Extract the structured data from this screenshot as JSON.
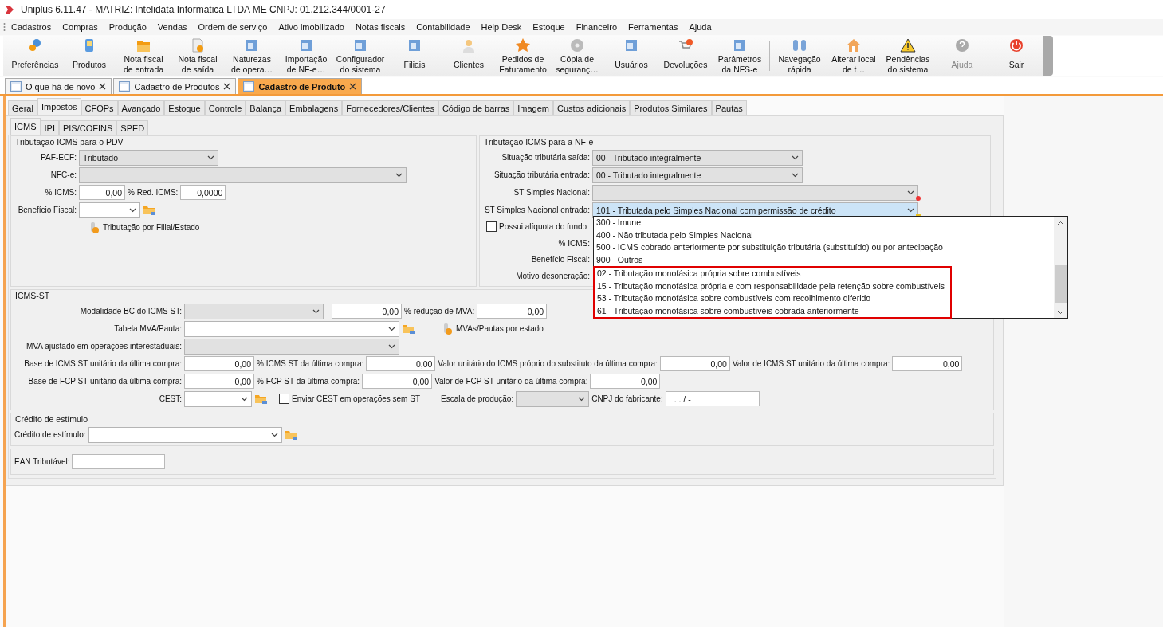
{
  "window": {
    "title": "Uniplus 6.11.47 - MATRIZ: Intelidata Informatica LTDA ME CNPJ: 01.212.344/0001-27"
  },
  "menu": [
    "Cadastros",
    "Compras",
    "Produção",
    "Vendas",
    "Ordem de serviço",
    "Ativo imobilizado",
    "Notas fiscais",
    "Contabilidade",
    "Help Desk",
    "Estoque",
    "Financeiro",
    "Ferramentas",
    "Ajuda"
  ],
  "toolbar": {
    "groups": [
      {
        "buttons": [
          {
            "label": "Preferências",
            "disabled": false
          },
          {
            "label": "Produtos",
            "disabled": false
          },
          {
            "label": "Nota fiscal\nde entrada",
            "disabled": false
          },
          {
            "label": "Nota fiscal\nde saída",
            "disabled": false
          },
          {
            "label": "Naturezas\nde opera…",
            "disabled": false
          },
          {
            "label": "Importação\nde NF-e…",
            "disabled": false
          },
          {
            "label": "Configurador\ndo sistema",
            "disabled": false
          },
          {
            "label": "Filiais",
            "disabled": false
          },
          {
            "label": "Clientes",
            "disabled": false
          },
          {
            "label": "Pedidos de\nFaturamento",
            "disabled": false
          },
          {
            "label": "Cópia de\nseguranç…",
            "disabled": false
          },
          {
            "label": "Usuários",
            "disabled": false
          },
          {
            "label": "Devoluções",
            "disabled": false
          },
          {
            "label": "Parâmetros\nda NFS-e",
            "disabled": false
          }
        ]
      },
      {
        "buttons": [
          {
            "label": "Navegação\nrápida",
            "disabled": false
          },
          {
            "label": "Alterar local\nde t…",
            "disabled": false
          },
          {
            "label": "Pendências\ndo sistema",
            "disabled": false
          },
          {
            "label": "Ajuda",
            "disabled": true
          },
          {
            "label": "Sair",
            "disabled": false
          }
        ]
      }
    ]
  },
  "doc_tabs": [
    {
      "label": "O que há de novo",
      "selected": false
    },
    {
      "label": "Cadastro de Produtos",
      "selected": false
    },
    {
      "label": "Cadastro de Produto",
      "selected": true
    }
  ],
  "tabs": [
    {
      "label": "Geral",
      "selected": false
    },
    {
      "label": "Impostos",
      "selected": true
    },
    {
      "label": "CFOPs",
      "selected": false
    },
    {
      "label": "Avançado",
      "selected": false
    },
    {
      "label": "Estoque",
      "selected": false
    },
    {
      "label": "Controle",
      "selected": false
    },
    {
      "label": "Balança",
      "selected": false
    },
    {
      "label": "Embalagens",
      "selected": false
    },
    {
      "label": "Fornecedores/Clientes",
      "selected": false
    },
    {
      "label": "Código de barras",
      "selected": false
    },
    {
      "label": "Imagem",
      "selected": false
    },
    {
      "label": "Custos adicionais",
      "selected": false
    },
    {
      "label": "Produtos Similares",
      "selected": false
    },
    {
      "label": "Pautas",
      "selected": false
    }
  ],
  "subtabs": [
    {
      "label": "ICMS",
      "selected": true
    },
    {
      "label": "IPI",
      "selected": false
    },
    {
      "label": "PIS/COFINS",
      "selected": false
    },
    {
      "label": "SPED",
      "selected": false
    }
  ],
  "pdv": {
    "title": "Tributação ICMS para o PDV",
    "paf_ecf": {
      "label": "PAF-ECF:",
      "value": "Tributado",
      "editable": false
    },
    "nfce": {
      "label": "NFC-e:",
      "editable": false
    },
    "icms": {
      "label": "% ICMS:",
      "value": "0,00"
    },
    "red_icms": {
      "label": "% Red. ICMS:",
      "value": "0,0000"
    },
    "beneficio": {
      "label": "Benefício Fiscal:",
      "editable": true
    },
    "link": {
      "label": "Tributação por Filial/Estado"
    }
  },
  "nfe": {
    "title": "Tributação ICMS para a NF-e",
    "rows": [
      {
        "label": "Situação tributária saída:",
        "value": "00 - Tributado integralmente",
        "focused": false,
        "error": false,
        "warning": false
      },
      {
        "label": "Situação tributária entrada:",
        "value": "00 - Tributado integralmente",
        "focused": false,
        "error": false,
        "warning": false
      },
      {
        "label": "ST Simples Nacional:",
        "focused": false,
        "error": true,
        "warning": false
      },
      {
        "label": "ST Simples Nacional entrada:",
        "value": "101 - Tributada pelo Simples Nacional com permissão de crédito",
        "focused": true,
        "error": false,
        "warning": true
      }
    ],
    "fundo": {
      "label": "Possui alíquota do fundo",
      "checked": false
    },
    "icms_label": "% ICMS:",
    "beneficio_label": "Benefício Fiscal:",
    "motivo_label": "Motivo desoneração:"
  },
  "dropdown": {
    "items": [
      {
        "label": "300 - Imune",
        "highlighted": false
      },
      {
        "label": "400 - Não tributada pelo Simples Nacional",
        "highlighted": false
      },
      {
        "label": "500 - ICMS cobrado anteriormente por substituição tributária (substituído) ou por antecipação",
        "highlighted": false
      },
      {
        "label": "900 - Outros",
        "highlighted": false
      },
      {
        "label": "02 - Tributação monofásica própria sobre combustíveis",
        "highlighted": true
      },
      {
        "label": "15 - Tributação monofásica própria e com responsabilidade pela retenção sobre combustíveis",
        "highlighted": true
      },
      {
        "label": "53 - Tributação monofásica sobre combustíveis com recolhimento diferido",
        "highlighted": true
      },
      {
        "label": "61 - Tributação monofásica sobre combustíveis cobrada anteriormente",
        "highlighted": true
      }
    ]
  },
  "icms_st": {
    "title": "ICMS-ST",
    "modalidade": {
      "label": "Modalidade BC do ICMS ST:",
      "editable": false
    },
    "modalidade_valor": {
      "value": "0,00"
    },
    "reducao_mva": {
      "label": "% redução de MVA:",
      "value": "0,00"
    },
    "tabela": {
      "label": "Tabela MVA/Pauta:",
      "editable": true
    },
    "mvas_link": {
      "label": "MVAs/Pautas por estado"
    },
    "mva_ajustado": {
      "label": "MVA ajustado em operações interestaduais:",
      "editable": false
    },
    "base_icms_st": {
      "label": "Base de ICMS ST unitário da última compra:",
      "value": "0,00"
    },
    "pct_icms_st": {
      "label": "% ICMS ST da última compra:",
      "value": "0,00"
    },
    "valor_icms_proprio": {
      "label": "Valor unitário do ICMS próprio do substituto da última compra:",
      "value": "0,00"
    },
    "valor_icms_st": {
      "label": "Valor de ICMS ST unitário da última compra:",
      "value": "0,00"
    },
    "base_fcp": {
      "label": "Base de FCP ST unitário da última compra:",
      "value": "0,00"
    },
    "pct_fcp": {
      "label": "% FCP ST da última compra:",
      "value": "0,00"
    },
    "valor_fcp": {
      "label": "Valor de FCP ST unitário da última compra:",
      "value": "0,00"
    },
    "cest": {
      "label": "CEST:",
      "editable": true
    },
    "enviar_cest": {
      "label": "Enviar CEST em operações sem ST",
      "checked": false
    },
    "escala": {
      "label": "Escala de produção:",
      "editable": false
    },
    "cnpj": {
      "label": "CNPJ do fabricante:",
      "value": ". . / -"
    }
  },
  "credito": {
    "title": "Crédito de estímulo",
    "field": {
      "label": "Crédito de estímulo:",
      "editable": true
    }
  },
  "ean": {
    "label": "EAN Tributável:"
  }
}
